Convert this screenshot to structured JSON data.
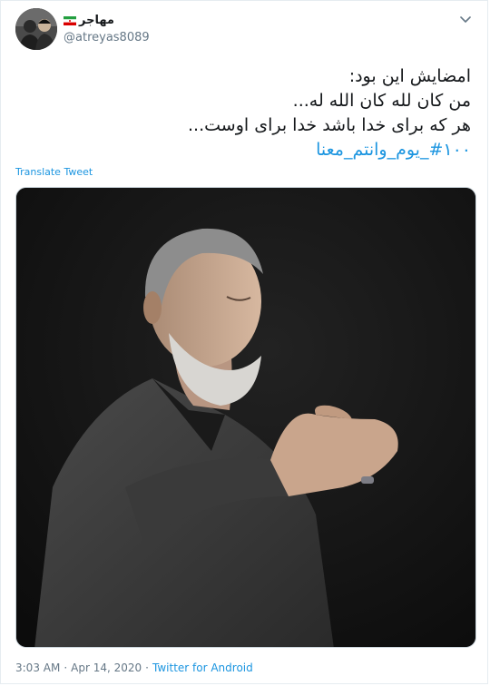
{
  "author": {
    "display_name": "مهاجر",
    "handle": "@atreyas8089",
    "avatar_icon": "user-avatar-photo",
    "flag_icon": "iran-flag-icon"
  },
  "tweet": {
    "lines": [
      "امضایش این بود:",
      "من کان لله کان الله له...",
      "هر که برای خدا باشد خدا برای اوست..."
    ],
    "hashtag": "#۱۰۰_یوم_وانتم_معنا",
    "translate_label": "Translate Tweet"
  },
  "media": {
    "description_icon": "photo-praying-man"
  },
  "meta": {
    "time": "3:03 AM",
    "sep1": "·",
    "date": "Apr 14, 2020",
    "sep2": "·",
    "source": "Twitter for Android"
  },
  "colors": {
    "link": "#1b95e0",
    "secondary": "#657786",
    "text": "#14171a"
  }
}
